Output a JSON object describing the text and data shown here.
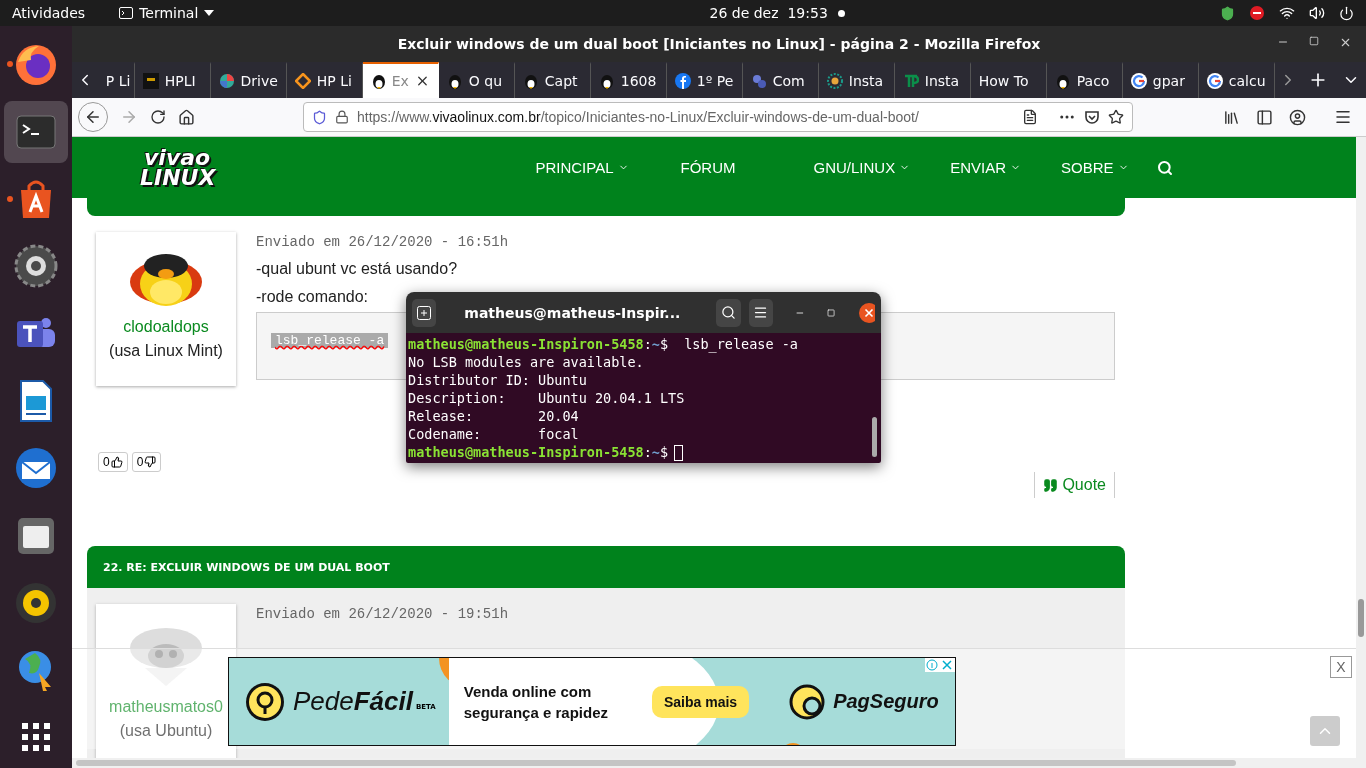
{
  "top_panel": {
    "activities": "Atividades",
    "app_menu": "Terminal",
    "clock": "26 de dez  19:53"
  },
  "dock": [
    {
      "kind": "firefox",
      "running": true,
      "selected": false
    },
    {
      "kind": "terminal",
      "running": false,
      "selected": true
    },
    {
      "kind": "appstore",
      "running": true,
      "selected": false
    },
    {
      "kind": "settings",
      "running": false,
      "selected": false
    },
    {
      "kind": "teams",
      "running": false,
      "selected": false
    },
    {
      "kind": "writer",
      "running": false,
      "selected": false
    },
    {
      "kind": "mail",
      "running": false,
      "selected": false
    },
    {
      "kind": "files",
      "running": false,
      "selected": false
    },
    {
      "kind": "speaker",
      "running": false,
      "selected": false
    },
    {
      "kind": "globe",
      "running": false,
      "selected": false
    },
    {
      "kind": "apps",
      "running": false,
      "selected": false
    }
  ],
  "browser": {
    "title": "Excluir windows de um dual boot [Iniciantes no Linux] - página 2 - Mozilla Firefox",
    "tabs": [
      {
        "label": "P Li",
        "kind": "plain",
        "selected": false
      },
      {
        "label": "HPLI",
        "kind": "dark",
        "selected": false
      },
      {
        "label": "Drive",
        "kind": "drive",
        "selected": false
      },
      {
        "label": "HP Li",
        "kind": "diamond",
        "selected": false
      },
      {
        "label": "Ex",
        "kind": "tux",
        "selected": true
      },
      {
        "label": "O qu",
        "kind": "tux",
        "selected": false
      },
      {
        "label": "Capt",
        "kind": "tux",
        "selected": false
      },
      {
        "label": "1608",
        "kind": "tux",
        "selected": false
      },
      {
        "label": "1º Pe",
        "kind": "facebook",
        "selected": false
      },
      {
        "label": "Com",
        "kind": "bubbles",
        "selected": false
      },
      {
        "label": "Insta",
        "kind": "gear",
        "selected": false
      },
      {
        "label": "Insta",
        "kind": "tp",
        "selected": false
      },
      {
        "label": "How To",
        "kind": "plain",
        "selected": false
      },
      {
        "label": "Paco",
        "kind": "tux",
        "selected": false
      },
      {
        "label": "gpar",
        "kind": "google",
        "selected": false
      },
      {
        "label": "calcu",
        "kind": "google",
        "selected": false
      }
    ],
    "url": {
      "scheme": "https://www.",
      "domain": "vivaolinux.com.br",
      "path": "/topico/Iniciantes-no-Linux/Excluir-windows-de-um-dual-boot/"
    }
  },
  "site": {
    "logo_top": "vivao",
    "logo_bottom": "LINUX",
    "nav": [
      {
        "label": "PRINCIPAL",
        "has_menu": true
      },
      {
        "label": "FÓRUM",
        "has_menu": false
      },
      {
        "label": "GNU/LINUX",
        "has_menu": true
      },
      {
        "label": "ENVIAR",
        "has_menu": true
      },
      {
        "label": "SOBRE",
        "has_menu": true
      }
    ]
  },
  "posts": [
    {
      "user": "clodoaldops",
      "distro": "(usa Linux Mint)",
      "date": "Enviado em 26/12/2020 - 16:51h",
      "paragraphs": [
        "-qual ubunt vc está usando?",
        "-rode comando:"
      ],
      "code": "lsb_release -a",
      "likes": "0",
      "dislikes": "0",
      "quote": "Quote"
    },
    {
      "header": "22. RE: EXCLUIR WINDOWS DE UM DUAL BOOT",
      "user": "matheusmatos0",
      "distro": "(usa Ubuntu)",
      "date": "Enviado em 26/12/2020 - 19:51h"
    }
  ],
  "terminal": {
    "title": "matheus@matheus-Inspir...",
    "lines": [
      {
        "kind": "prompt",
        "user": "matheus@matheus-Inspiron-5458",
        "sep": ":",
        "path": "~",
        "symbol": "$",
        "command": "lsb_release -a",
        "cursor": false
      },
      {
        "kind": "output",
        "text": "No LSB modules are available."
      },
      {
        "kind": "output",
        "text": "Distributor ID: Ubuntu"
      },
      {
        "kind": "output",
        "text": "Description:    Ubuntu 20.04.1 LTS"
      },
      {
        "kind": "output",
        "text": "Release:        20.04"
      },
      {
        "kind": "output",
        "text": "Codename:       focal"
      },
      {
        "kind": "prompt",
        "user": "matheus@matheus-Inspiron-5458",
        "sep": ":",
        "path": "~",
        "symbol": "$",
        "cursor": true
      }
    ]
  },
  "ad": {
    "brand": "Pede**Fácil**",
    "beta": "BETA",
    "tagline_1": "Venda online com",
    "tagline_2": "segurança e rapidez",
    "cta": "Saiba mais",
    "partner": "PagSeguro",
    "close": "X"
  }
}
